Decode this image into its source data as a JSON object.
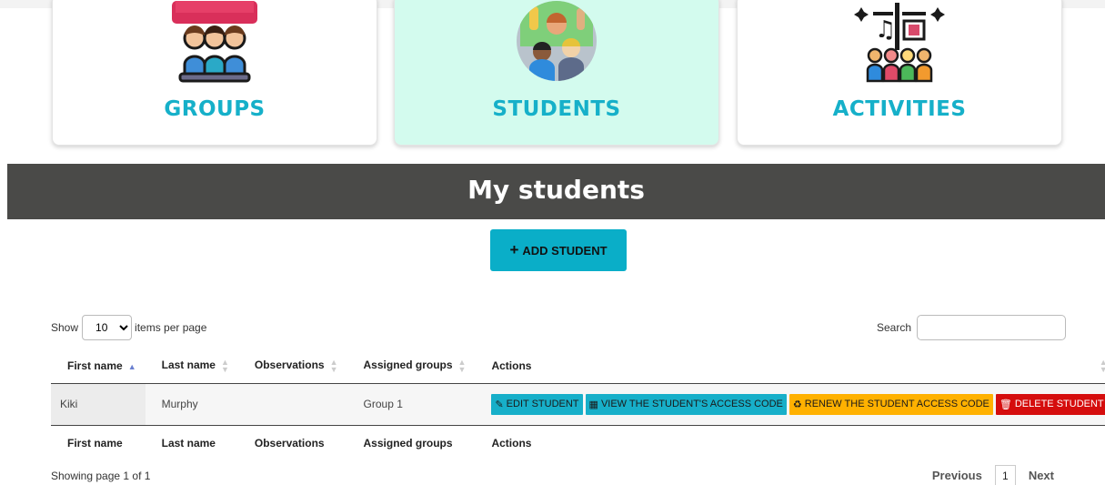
{
  "cards": [
    {
      "title": "GROUPS"
    },
    {
      "title": "STUDENTS"
    },
    {
      "title": "ACTIVITIES"
    }
  ],
  "banner": {
    "title": "My students"
  },
  "add_button": {
    "label": "ADD STUDENT"
  },
  "table_controls": {
    "show_label": "Show",
    "page_size": "10",
    "items_label": "items per page",
    "search_label": "Search",
    "search_value": ""
  },
  "table": {
    "columns": [
      "First name",
      "Last name",
      "Observations",
      "Assigned groups",
      "Actions"
    ],
    "rows": [
      {
        "first_name": "Kiki",
        "last_name": "Murphy",
        "observations": "",
        "groups": "Group 1"
      }
    ],
    "actions": {
      "edit": "EDIT STUDENT",
      "view": "VIEW THE STUDENT'S ACCESS CODE",
      "renew": "RENEW THE STUDENT ACCESS CODE",
      "delete": "DELETE STUDENT"
    }
  },
  "footer": {
    "showing": "Showing page 1 of 1",
    "previous": "Previous",
    "page": "1",
    "next": "Next"
  },
  "colors": {
    "accent": "#0aaec8",
    "card_active": "#d3fbee",
    "banner": "#4a4a48",
    "renew": "#ffb100",
    "delete": "#d50d0d"
  }
}
